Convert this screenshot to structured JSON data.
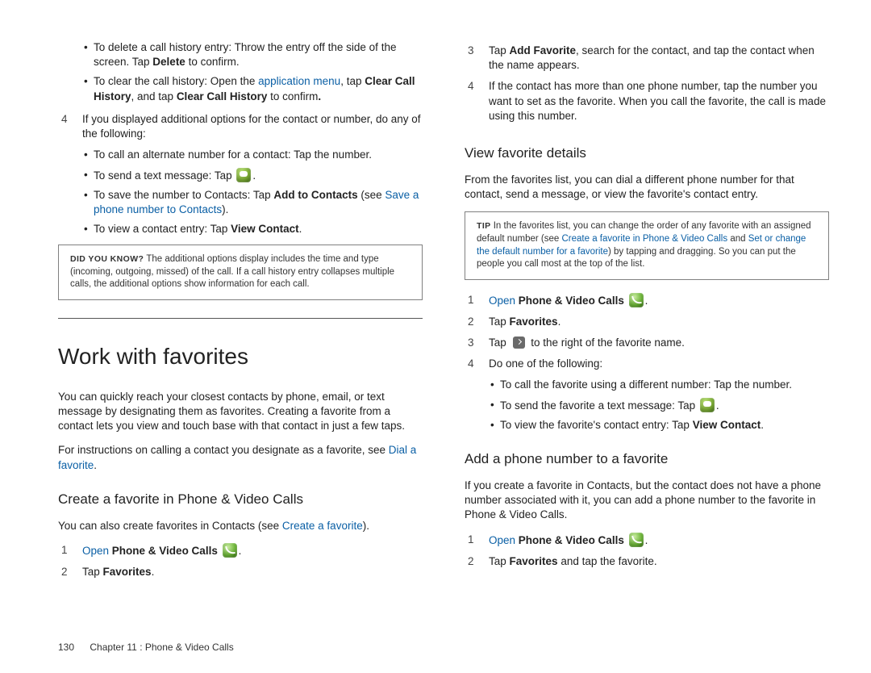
{
  "left": {
    "intro_bullets": {
      "b1a": "To delete a call history entry: Throw the entry off the side of the screen. Tap ",
      "b1b": "Delete",
      "b1c": " to confirm.",
      "b2a": "To clear the call history: Open the ",
      "b2link": "application menu",
      "b2b": ", tap ",
      "b2bold1": "Clear Call History",
      "b2c": ", and tap ",
      "b2bold2": "Clear Call History",
      "b2d": " to confirm",
      "b2e": "."
    },
    "step4": {
      "num": "4",
      "text": "If you displayed additional options for the contact or number, do any of the following:"
    },
    "sub": {
      "s1": "To call an alternate number for a contact: Tap the number.",
      "s2a": "To send a text message: Tap ",
      "s2b": ".",
      "s3a": "To save the number to Contacts: Tap ",
      "s3bold": "Add to Contacts",
      "s3b": " (see ",
      "s3link": "Save a phone number to Contacts",
      "s3c": ").",
      "s4a": "To view a contact entry: Tap ",
      "s4bold": "View Contact",
      "s4b": "."
    },
    "dyk_label": "DID YOU KNOW?",
    "dyk_text": " The additional options display includes the time and type (incoming, outgoing, missed) of the call. If a call history entry collapses multiple calls, the additional options show information for each call.",
    "h1": "Work with favorites",
    "p1": "You can quickly reach your closest contacts by phone, email, or text message by designating them as favorites. Creating a favorite from a contact lets you view and touch base with that contact in just a few taps.",
    "p2a": "For instructions on calling a contact you designate as a favorite, see ",
    "p2link": "Dial a favorite",
    "p2b": ".",
    "h2": "Create a favorite in Phone & Video Calls",
    "p3a": "You can also create favorites in Contacts (see ",
    "p3link": "Create a favorite",
    "p3b": ").",
    "steps": {
      "s1num": "1",
      "s1link": "Open",
      "s1bold": "Phone & Video Calls",
      "s1dot": ".",
      "s2num": "2",
      "s2a": "Tap ",
      "s2bold": "Favorites",
      "s2b": "."
    }
  },
  "right": {
    "steps_top": {
      "s3num": "3",
      "s3a": "Tap ",
      "s3bold": "Add Favorite",
      "s3b": ", search for the contact, and tap the contact when the name appears.",
      "s4num": "4",
      "s4": "If the contact has more than one phone number, tap the number you want to set as the favorite. When you call the favorite, the call is made using this number."
    },
    "h2a": "View favorite details",
    "p1": "From the favorites list, you can dial a different phone number for that contact, send a message, or view the favorite's contact entry.",
    "tip_label": "TIP",
    "tip_a": " In the favorites list, you can change the order of any favorite with an assigned default number (see ",
    "tip_link1": "Create a favorite in Phone & Video Calls",
    "tip_mid": " and ",
    "tip_link2": "Set or change the default number for a favorite",
    "tip_b": ") by tapping and dragging. So you can put the people you call most at the top of the list.",
    "stepsA": {
      "s1num": "1",
      "s1link": "Open",
      "s1bold": "Phone & Video Calls",
      "s1dot": ".",
      "s2num": "2",
      "s2a": "Tap ",
      "s2bold": "Favorites",
      "s2b": ".",
      "s3num": "3",
      "s3a": "Tap ",
      "s3b": " to the right of the favorite name.",
      "s4num": "4",
      "s4": "Do one of the following:"
    },
    "sub": {
      "u1": "To call the favorite using a different number: Tap the number.",
      "u2a": "To send the favorite a text message: Tap ",
      "u2b": ".",
      "u3a": "To view the favorite's contact entry: Tap ",
      "u3bold": "View Contact",
      "u3b": "."
    },
    "h2b": "Add a phone number to a favorite",
    "p2": "If you create a favorite in Contacts, but the contact does not have a phone number associated with it, you can add a phone number to the favorite in Phone & Video Calls.",
    "stepsB": {
      "s1num": "1",
      "s1link": "Open",
      "s1bold": "Phone & Video Calls",
      "s1dot": ".",
      "s2num": "2",
      "s2a": "Tap ",
      "s2bold": "Favorites",
      "s2b": " and tap the favorite."
    }
  },
  "footer": {
    "page": "130",
    "chapter": "Chapter 11 : Phone & Video Calls"
  }
}
